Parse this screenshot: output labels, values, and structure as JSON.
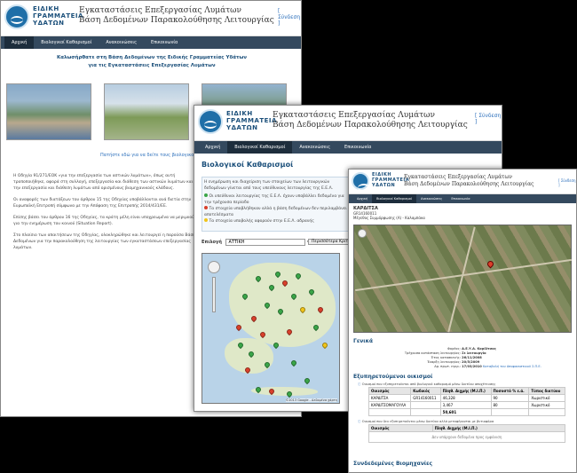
{
  "common": {
    "org_line1": "ΕΙΔΙΚΗ",
    "org_line2": "ΓΡΑΜΜΑΤΕΙΑ",
    "org_line3": "ΥΔΑΤΩΝ",
    "title_line1": "Εγκαταστάσεις Επεξεργασίας Λυμάτων",
    "title_line2": "Βάση Δεδομένων Παρακολούθησης Λειτουργίας",
    "login": "[ Σύνδεση ]",
    "nav": [
      "Αρχική",
      "Βιολογικοί Καθαρισμοί",
      "Ανακοινώσεις",
      "Επικοινωνία"
    ]
  },
  "window1": {
    "heading_line1": "Καλωσήρθατε στη Βάση Δεδομένων της Ειδικής Γραμματείας Υδάτων",
    "heading_line2": "για τις Εγκαταστάσεις Επεξεργασίας Λυμάτων",
    "caption": "Πατήστε εδώ για να δείτε τους βιολογικούς καθαρισμούς",
    "para1": "Η Οδηγία 91/271/ΕΟΚ «για την επεξεργασία των αστικών λυμάτων», όπως αυτή τροποποιήθηκε, αφορά στη συλλογή, επεξεργασία και διάθεση των αστικών λυμάτων και την επεξεργασία και διάθεση λυμάτων από ορισμένους βιομηχανικούς κλάδους.",
    "para2": "Οι αναφορές των διατάξεων του άρθρου 15 της Οδηγίας υποβάλλονται ανά διετία στην Ευρωπαϊκή Επιτροπή σύμφωνα με την Απόφαση της Επιτροπής 2014/431/ΕΕ.",
    "para3": "Επίσης βάσει του άρθρου 16 της Οδηγίας, τα κράτη μέλη είναι υποχρεωμένα να μεριμνούν για την ενημέρωση του κοινού (Situation Report).",
    "para4": "Στο πλαίσιο των απαιτήσεων της Οδηγίας, ολοκληρώθηκε και λειτουργεί η παρούσα Βάση Δεδομένων για την παρακολούθηση της λειτουργίας των εγκαταστάσεων επεξεργασίας λυμάτων."
  },
  "window2": {
    "section_title": "Βιολογικοί Καθαρισμοί",
    "intro": "Η ενημέρωση και διαχείριση των στοιχείων των λειτουργικών δεδομένων γίνεται από τους υπεύθυνους λειτουργίας της Ε.Ε.Λ.",
    "legend": [
      "Οι υπεύθυνοι λειτουργίας της Ε.Ε.Λ. έχουν υποβάλλει δεδομένα για την τρέχουσα περίοδο",
      "Τα στοιχεία υποβλήθηκαν αλλά η βάση δεδομένων δεν περιλαμβάνει αποτελέσματα",
      "Τα στοιχεία υποβολής αφορούν στην Ε.Ε.Λ. αδρανής"
    ],
    "filter_label": "Επιλογή",
    "filter_value": "ΑΤΤΙΚΗ",
    "criteria_button": "Περισσότερα Κριτήρια",
    "map_attribution": "©2013 Google - Δεδομένα χάρτη",
    "colors": {
      "green": "#3aa548",
      "red": "#d9402b",
      "yellow": "#f0c419"
    }
  },
  "window3": {
    "plant_name": "ΚΑΡΔΙΤΣΑ",
    "plant_code": "GR14160011",
    "plant_subtitle": "Μέγεθος Συμμόρφωσης (Α) - Καλαμπάκα",
    "general_heading": "Γενικά",
    "general_rows": [
      {
        "label": "Φορέας:",
        "value": "Δ.Ε.Υ.Α. Καρδίτσας"
      },
      {
        "label": "Τρέχουσα κατάσταση λειτουργίας:",
        "value": "Σε λειτουργία"
      },
      {
        "label": "Έτος κατασκευής:",
        "value": "26/11/2008"
      },
      {
        "label": "Έναρξη λειτουργίας:",
        "value": "20/5/2009"
      },
      {
        "label": "Αρ. πρωτ. εγκρ.:",
        "value": "17/03/2010"
      }
    ],
    "general_link": "Καταβολή του Αποφασιστικού Σ.Π.Ε.",
    "served_heading": "Εξυπηρετούμενοι οικισμοί",
    "served_note": "Οικισμοί που εξυπηρετούνται από βιολογικό καθαρισμό μέσω δικτύου αποχέτευσης",
    "served_headers": [
      "Οικισμός",
      "Κωδικός",
      "Πληθ. Αιχμής (Μ.Ι.Π.)",
      "Ποσοστό % ε.ά.",
      "Τύπος δικτύου"
    ],
    "served_rows": [
      [
        "ΚΑΡΔΙΤΣΑ",
        "GR14160011",
        "46,328",
        "90",
        "Χωριστικό"
      ],
      [
        "ΚΑΡΔΙΤΣΟΜΑΓΟΥΛΑ",
        "",
        "3,467",
        "80",
        "Χωριστικό"
      ]
    ],
    "served_total": "50,601",
    "trucked_note": "Οικισμοί που δεν εξυπηρετούνται μέσω δικτύου αλλά μεταφέρονται με βυτιοφόρα",
    "trucked_headers": [
      "Οικισμός",
      "Πληθ. Αιχμής (Μ.Ι.Π.)"
    ],
    "trucked_empty": "Δεν υπάρχουν δεδομένα προς εμφάνιση",
    "industry_heading": "Συνδεδεμένες Βιομηχανίες"
  }
}
